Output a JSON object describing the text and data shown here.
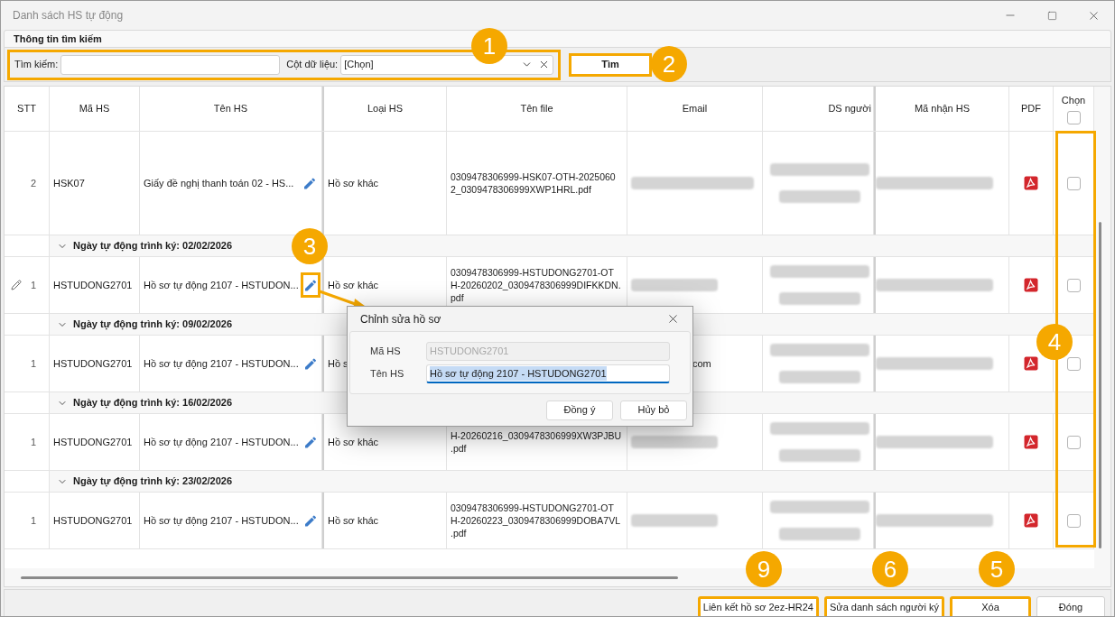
{
  "window": {
    "title": "Danh sách HS tự động"
  },
  "search_panel": {
    "title": "Thông tin tìm kiếm",
    "search_label": "Tìm kiếm:",
    "column_label": "Cột dữ liệu:",
    "column_value": "[Chọn]",
    "search_button": "Tìm",
    "highlighted": true,
    "button_highlighted": true
  },
  "table": {
    "columns": [
      "STT",
      "Mã HS",
      "Tên HS",
      "Loại HS",
      "Tên file",
      "Email",
      "DS người",
      "Mã nhận HS",
      "PDF",
      "Chọn"
    ],
    "select_all_checked": false,
    "items": [
      {
        "kind": "row",
        "stt": "2",
        "ma_hs": "HSK07",
        "ten_hs": "Giấy đề nghị thanh toán 02 - HS...",
        "loai_hs": "Hồ sơ khác",
        "file_lines": [
          "0309478306999-HSK07-OTH-2025060",
          "2_0309478306999XWP1HRL.pdf"
        ],
        "editing": false,
        "highlighted": false,
        "checked": false
      },
      {
        "kind": "group",
        "label": "Ngày tự động trình ký: 02/02/2026",
        "expanded": true
      },
      {
        "kind": "row",
        "stt": "1",
        "ma_hs": "HSTUDONG2701",
        "ten_hs": "Hồ sơ tự động 2107 - HSTUDON...",
        "loai_hs": "Hồ sơ khác",
        "file_lines": [
          "0309478306999-HSTUDONG2701-OT",
          "H-20260202_0309478306999DIFKKDN.",
          "pdf"
        ],
        "editing": true,
        "highlighted": true,
        "checked": false
      },
      {
        "kind": "group",
        "label": "Ngày tự động trình ký: 09/02/2026",
        "expanded": true
      },
      {
        "kind": "row",
        "stt": "1",
        "ma_hs": "HSTUDONG2701",
        "ten_hs": "Hồ sơ tự động 2107 - HSTUDON...",
        "loai_hs": "Hồ s",
        "email": "com",
        "editing": false,
        "highlighted": false,
        "checked": false
      },
      {
        "kind": "group",
        "label": "Ngày tự động trình ký: 16/02/2026",
        "expanded": true
      },
      {
        "kind": "row",
        "stt": "1",
        "ma_hs": "HSTUDONG2701",
        "ten_hs": "Hồ sơ tự động 2107 - HSTUDON...",
        "loai_hs": "Hồ sơ khác",
        "file_lines": [
          "H-20260216_0309478306999XW3PJBU",
          ".pdf"
        ],
        "editing": false,
        "highlighted": false,
        "checked": false
      },
      {
        "kind": "group",
        "label": "Ngày tự động trình ký: 23/02/2026",
        "expanded": true
      },
      {
        "kind": "row",
        "stt": "1",
        "ma_hs": "HSTUDONG2701",
        "ten_hs": "Hồ sơ tự động 2107 - HSTUDON...",
        "loai_hs": "Hồ sơ khác",
        "file_lines": [
          "0309478306999-HSTUDONG2701-OT",
          "H-20260223_0309478306999DOBA7VL",
          ".pdf"
        ],
        "editing": false,
        "highlighted": false,
        "checked": false
      }
    ]
  },
  "dialog": {
    "title": "Chỉnh sửa hồ sơ",
    "fields": [
      {
        "label": "Mã HS",
        "value": "HSTUDONG2701",
        "disabled": true
      },
      {
        "label": "Tên HS",
        "value": "Hồ sơ tự động 2107 - HSTUDONG2701",
        "disabled": false
      }
    ],
    "buttons": [
      "Đồng ý",
      "Hủy bỏ"
    ]
  },
  "footer_buttons": [
    {
      "label": "Liên kết hồ sơ 2ez-HR24",
      "highlighted": true
    },
    {
      "label": "Sửa danh sách người ký",
      "highlighted": true
    },
    {
      "label": "Xóa",
      "highlighted": true
    },
    {
      "label": "Đóng",
      "highlighted": false
    }
  ],
  "annotations": [
    "1",
    "2",
    "3",
    "4",
    "9",
    "6",
    "5"
  ]
}
